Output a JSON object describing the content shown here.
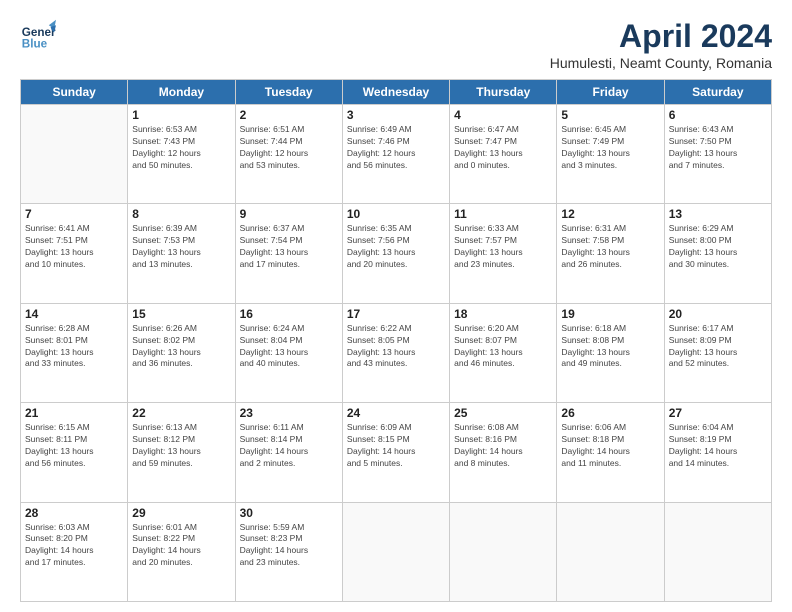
{
  "header": {
    "logo_general": "General",
    "logo_blue": "Blue",
    "title": "April 2024",
    "location": "Humulesti, Neamt County, Romania"
  },
  "days_of_week": [
    "Sunday",
    "Monday",
    "Tuesday",
    "Wednesday",
    "Thursday",
    "Friday",
    "Saturday"
  ],
  "weeks": [
    [
      {
        "day": "",
        "info": ""
      },
      {
        "day": "1",
        "info": "Sunrise: 6:53 AM\nSunset: 7:43 PM\nDaylight: 12 hours\nand 50 minutes."
      },
      {
        "day": "2",
        "info": "Sunrise: 6:51 AM\nSunset: 7:44 PM\nDaylight: 12 hours\nand 53 minutes."
      },
      {
        "day": "3",
        "info": "Sunrise: 6:49 AM\nSunset: 7:46 PM\nDaylight: 12 hours\nand 56 minutes."
      },
      {
        "day": "4",
        "info": "Sunrise: 6:47 AM\nSunset: 7:47 PM\nDaylight: 13 hours\nand 0 minutes."
      },
      {
        "day": "5",
        "info": "Sunrise: 6:45 AM\nSunset: 7:49 PM\nDaylight: 13 hours\nand 3 minutes."
      },
      {
        "day": "6",
        "info": "Sunrise: 6:43 AM\nSunset: 7:50 PM\nDaylight: 13 hours\nand 7 minutes."
      }
    ],
    [
      {
        "day": "7",
        "info": "Sunrise: 6:41 AM\nSunset: 7:51 PM\nDaylight: 13 hours\nand 10 minutes."
      },
      {
        "day": "8",
        "info": "Sunrise: 6:39 AM\nSunset: 7:53 PM\nDaylight: 13 hours\nand 13 minutes."
      },
      {
        "day": "9",
        "info": "Sunrise: 6:37 AM\nSunset: 7:54 PM\nDaylight: 13 hours\nand 17 minutes."
      },
      {
        "day": "10",
        "info": "Sunrise: 6:35 AM\nSunset: 7:56 PM\nDaylight: 13 hours\nand 20 minutes."
      },
      {
        "day": "11",
        "info": "Sunrise: 6:33 AM\nSunset: 7:57 PM\nDaylight: 13 hours\nand 23 minutes."
      },
      {
        "day": "12",
        "info": "Sunrise: 6:31 AM\nSunset: 7:58 PM\nDaylight: 13 hours\nand 26 minutes."
      },
      {
        "day": "13",
        "info": "Sunrise: 6:29 AM\nSunset: 8:00 PM\nDaylight: 13 hours\nand 30 minutes."
      }
    ],
    [
      {
        "day": "14",
        "info": "Sunrise: 6:28 AM\nSunset: 8:01 PM\nDaylight: 13 hours\nand 33 minutes."
      },
      {
        "day": "15",
        "info": "Sunrise: 6:26 AM\nSunset: 8:02 PM\nDaylight: 13 hours\nand 36 minutes."
      },
      {
        "day": "16",
        "info": "Sunrise: 6:24 AM\nSunset: 8:04 PM\nDaylight: 13 hours\nand 40 minutes."
      },
      {
        "day": "17",
        "info": "Sunrise: 6:22 AM\nSunset: 8:05 PM\nDaylight: 13 hours\nand 43 minutes."
      },
      {
        "day": "18",
        "info": "Sunrise: 6:20 AM\nSunset: 8:07 PM\nDaylight: 13 hours\nand 46 minutes."
      },
      {
        "day": "19",
        "info": "Sunrise: 6:18 AM\nSunset: 8:08 PM\nDaylight: 13 hours\nand 49 minutes."
      },
      {
        "day": "20",
        "info": "Sunrise: 6:17 AM\nSunset: 8:09 PM\nDaylight: 13 hours\nand 52 minutes."
      }
    ],
    [
      {
        "day": "21",
        "info": "Sunrise: 6:15 AM\nSunset: 8:11 PM\nDaylight: 13 hours\nand 56 minutes."
      },
      {
        "day": "22",
        "info": "Sunrise: 6:13 AM\nSunset: 8:12 PM\nDaylight: 13 hours\nand 59 minutes."
      },
      {
        "day": "23",
        "info": "Sunrise: 6:11 AM\nSunset: 8:14 PM\nDaylight: 14 hours\nand 2 minutes."
      },
      {
        "day": "24",
        "info": "Sunrise: 6:09 AM\nSunset: 8:15 PM\nDaylight: 14 hours\nand 5 minutes."
      },
      {
        "day": "25",
        "info": "Sunrise: 6:08 AM\nSunset: 8:16 PM\nDaylight: 14 hours\nand 8 minutes."
      },
      {
        "day": "26",
        "info": "Sunrise: 6:06 AM\nSunset: 8:18 PM\nDaylight: 14 hours\nand 11 minutes."
      },
      {
        "day": "27",
        "info": "Sunrise: 6:04 AM\nSunset: 8:19 PM\nDaylight: 14 hours\nand 14 minutes."
      }
    ],
    [
      {
        "day": "28",
        "info": "Sunrise: 6:03 AM\nSunset: 8:20 PM\nDaylight: 14 hours\nand 17 minutes."
      },
      {
        "day": "29",
        "info": "Sunrise: 6:01 AM\nSunset: 8:22 PM\nDaylight: 14 hours\nand 20 minutes."
      },
      {
        "day": "30",
        "info": "Sunrise: 5:59 AM\nSunset: 8:23 PM\nDaylight: 14 hours\nand 23 minutes."
      },
      {
        "day": "",
        "info": ""
      },
      {
        "day": "",
        "info": ""
      },
      {
        "day": "",
        "info": ""
      },
      {
        "day": "",
        "info": ""
      }
    ]
  ]
}
